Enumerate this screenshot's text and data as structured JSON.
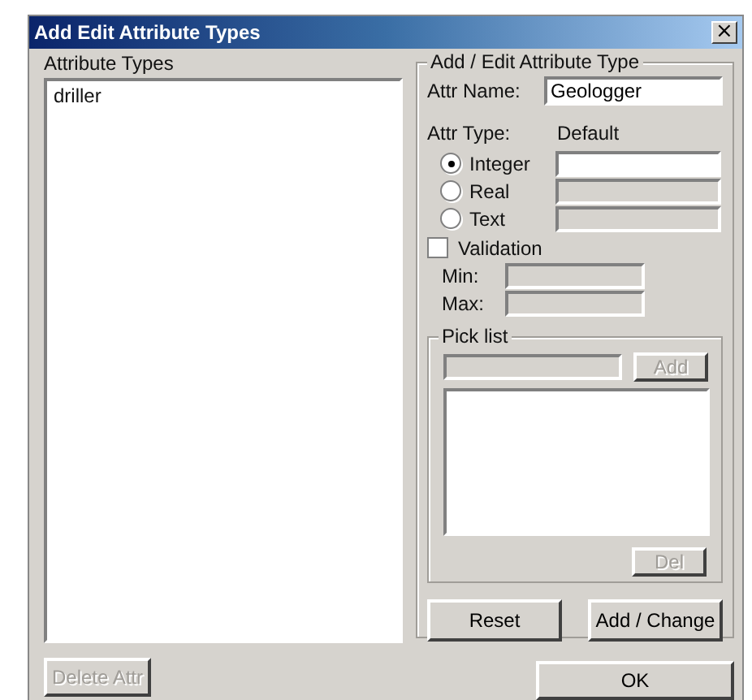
{
  "window": {
    "title": "Add Edit Attribute Types",
    "close": "×"
  },
  "attribute_types": {
    "label": "Attribute Types",
    "items": [
      {
        "text": "driller",
        "selected": false
      }
    ]
  },
  "delete_button": {
    "label": "Delete Attr",
    "disabled": true
  },
  "editor": {
    "title": "Add / Edit Attribute Type",
    "attr_name": {
      "label": "Attr Name:",
      "value": "Geologger"
    },
    "attr_type_label": "Attr Type:",
    "default_label": "Default",
    "types": [
      {
        "label": "Integer",
        "selected": true,
        "default_disabled": false
      },
      {
        "label": "Real",
        "selected": false,
        "default_disabled": true
      },
      {
        "label": "Text",
        "selected": false,
        "default_disabled": true
      }
    ],
    "validation": {
      "label": "Validation",
      "checked": false
    },
    "limits": [
      {
        "label": "Min:",
        "disabled": true
      },
      {
        "label": "Max:",
        "disabled": true
      }
    ],
    "pick_list": {
      "title": "Pick list",
      "entry_disabled": true,
      "add": {
        "label": "Add",
        "disabled": true
      },
      "del": {
        "label": "Del",
        "disabled": true
      }
    },
    "buttons": [
      {
        "label": "Reset"
      },
      {
        "label": "Add / Change"
      }
    ]
  },
  "ok_button": {
    "label": "OK"
  }
}
